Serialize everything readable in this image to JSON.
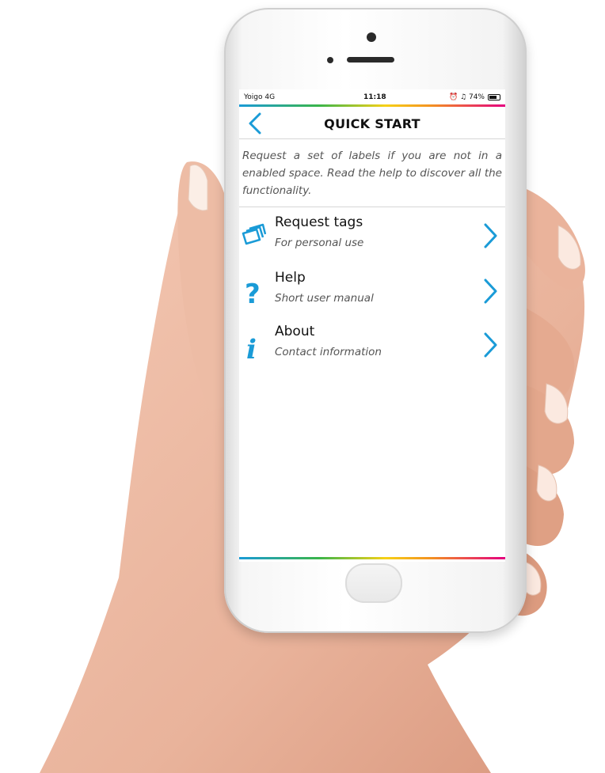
{
  "status_bar": {
    "carrier": "Yoigo 4G",
    "time": "11:18",
    "battery": "74%"
  },
  "header": {
    "title": "QUICK START"
  },
  "intro_text": "Request a set of labels if you are not in a enabled space. Read the help to discover all the functionality.",
  "menu": [
    {
      "title": "Request tags",
      "subtitle": "For personal use",
      "icon": "tags-icon"
    },
    {
      "title": "Help",
      "subtitle": "Short user manual",
      "icon": "question-icon"
    },
    {
      "title": "About",
      "subtitle": "Contact information",
      "icon": "info-icon"
    }
  ],
  "colors": {
    "accent": "#1a9bd7",
    "rainbow": [
      "#1a9bd7",
      "#3ab54a",
      "#f7d117",
      "#f39221",
      "#e4007f"
    ]
  }
}
